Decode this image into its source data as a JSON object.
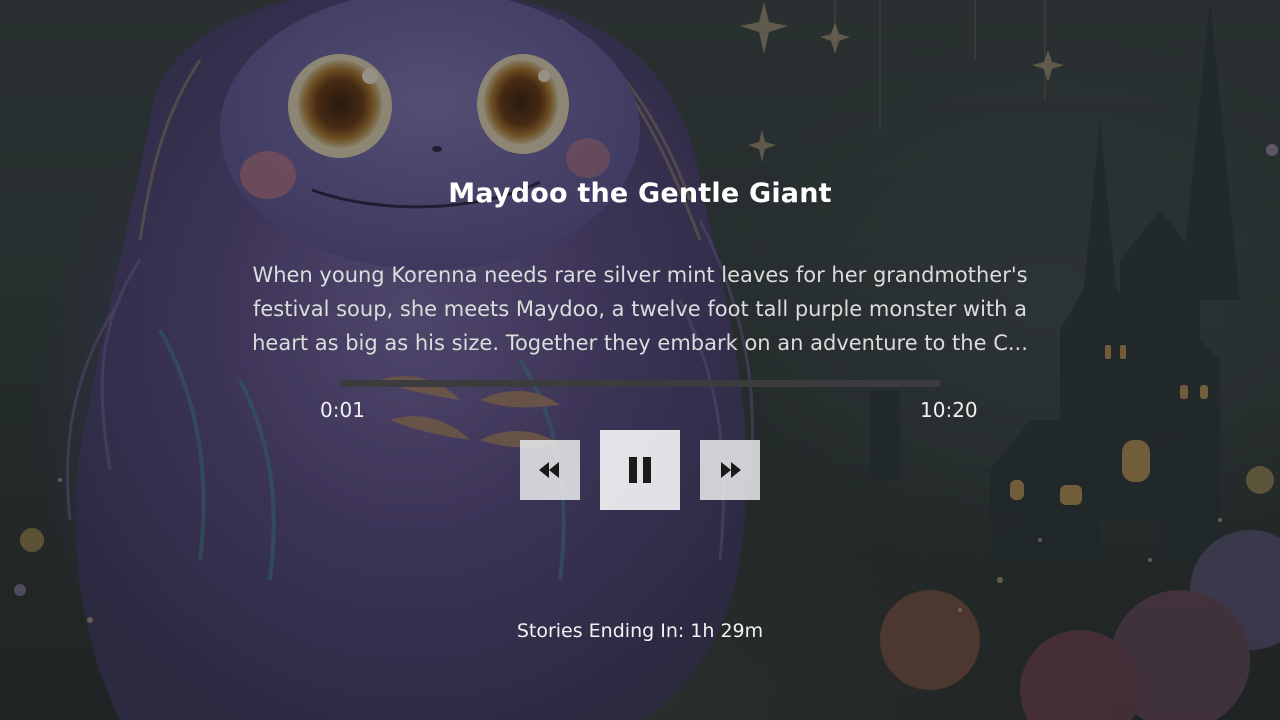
{
  "story": {
    "title": "Maydoo the Gentle Giant",
    "description_lines": [
      "When young Korenna needs rare silver mint leaves for her grandmother's",
      "festival soup, she meets Maydoo, a twelve foot tall purple monster with a",
      "heart as big as his size. Together they embark on an adventure to the C..."
    ]
  },
  "player": {
    "current_time": "0:01",
    "total_time": "10:20",
    "progress_fraction": 0.0,
    "rewind_icon": "rewind-icon",
    "pause_icon": "pause-icon",
    "fast_forward_icon": "fast-forward-icon"
  },
  "sleep_timer": {
    "label": "Stories Ending In: 1h 29m"
  },
  "colors": {
    "text_primary": "#ffffff",
    "progress_track": "#3c3c3f",
    "progress_fill": "#e8e8e8",
    "control_bg": "#e6e6e8",
    "icon_color": "#1a1a1a"
  }
}
